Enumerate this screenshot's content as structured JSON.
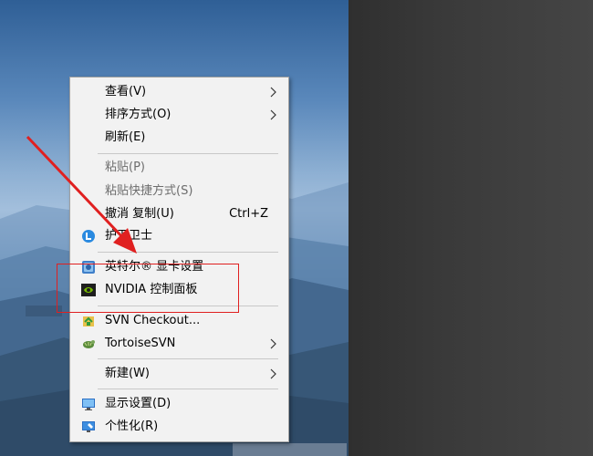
{
  "menu": {
    "items": [
      {
        "label": "查看(V)"
      },
      {
        "label": "排序方式(O)"
      },
      {
        "label": "刷新(E)"
      },
      {
        "label": "粘贴(P)"
      },
      {
        "label": "粘贴快捷方式(S)"
      },
      {
        "label": "撤消 复制(U)",
        "shortcut": "Ctrl+Z"
      },
      {
        "label": "护卫卫士",
        "icon": "guard-shield-icon"
      },
      {
        "label": "英特尔® 显卡设置",
        "icon": "intel-graphics-icon"
      },
      {
        "label": "NVIDIA 控制面板",
        "icon": "nvidia-icon"
      },
      {
        "label": "SVN Checkout...",
        "icon": "svn-checkout-icon"
      },
      {
        "label": "TortoiseSVN",
        "icon": "tortoisesvn-icon"
      },
      {
        "label": "新建(W)"
      },
      {
        "label": "显示设置(D)",
        "icon": "display-settings-icon"
      },
      {
        "label": "个性化(R)",
        "icon": "personalize-icon"
      }
    ]
  },
  "colors": {
    "menu_background": "#f2f2f2",
    "disabled_text": "#6d6d6d",
    "annotation_red": "#e02020"
  }
}
